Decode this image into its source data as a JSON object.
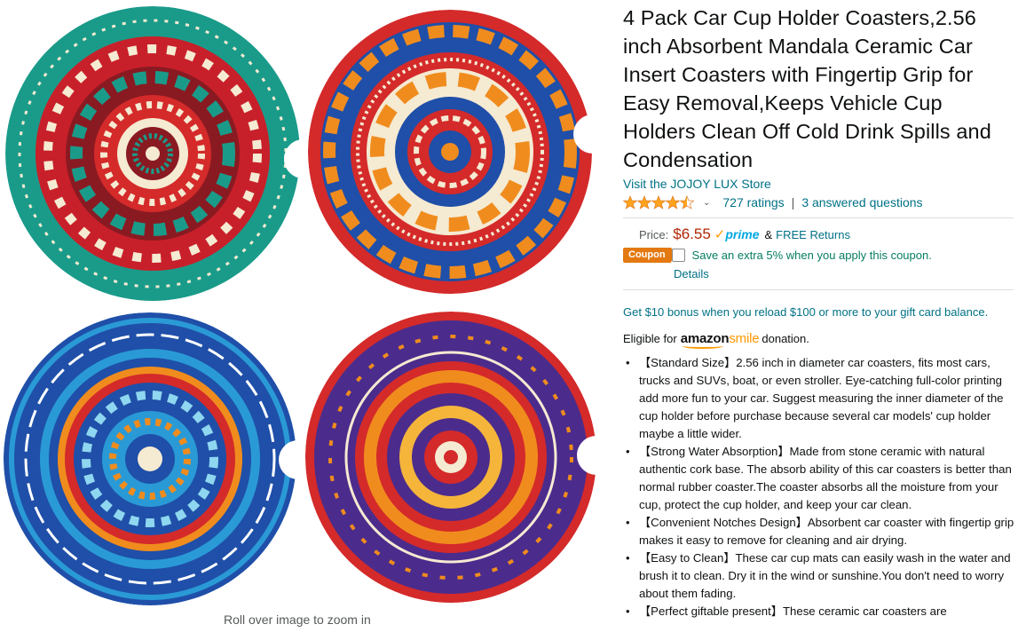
{
  "gallery": {
    "zoom_hint": "Roll over image to zoom in",
    "colors": {
      "teal": "#1a9b8a",
      "red": "#d42a2a",
      "blue": "#1f4fa8",
      "orange": "#f08c1e",
      "purple": "#4b2c8c",
      "cream": "#f5ead2"
    }
  },
  "product": {
    "title": "4 Pack Car Cup Holder Coasters,2.56 inch Absorbent Mandala Ceramic Car Insert Coasters with Fingertip Grip for Easy Removal,Keeps Vehicle Cup Holders Clean Off Cold Drink Spills and Condensation",
    "store_link": "Visit the JOJOY LUX Store",
    "rating_value": 4.5,
    "ratings_count": "727 ratings",
    "answered_questions": "3 answered questions",
    "price_label": "Price:",
    "price": "$6.55",
    "prime_label": "prime",
    "amp": "&",
    "free_returns": "FREE Returns",
    "coupon_badge": "Coupon",
    "coupon_text": "Save an extra 5% when you apply this coupon.",
    "details_link": "Details",
    "promo": "Get $10 bonus when you reload $100 or more to your gift card balance.",
    "smile_prefix": "Eligible for",
    "smile_amazon": "amazon",
    "smile_word": "smile",
    "smile_suffix": "donation.",
    "bullets": [
      "【Standard Size】2.56 inch in diameter car coasters, fits most cars, trucks and SUVs, boat, or even stroller. Eye-catching full-color printing add more fun to your car. Suggest measuring the inner diameter of the cup holder before purchase because several car models' cup holder maybe a little wider.",
      "【Strong Water Absorption】Made from stone ceramic with natural authentic cork base. The absorb ability of this car coasters is better than normal rubber coaster.The coaster absorbs all the moisture from your cup, protect the cup holder, and keep your car clean.",
      "【Convenient Notches Design】Absorbent car coaster with fingertip grip makes it easy to remove for cleaning and air drying.",
      "【Easy to Clean】These car cup mats can easily wash in the water and brush it to clean. Dry it in the wind or sunshine.You don't need to worry about them fading.",
      "【Perfect giftable present】These ceramic car coasters are"
    ]
  }
}
